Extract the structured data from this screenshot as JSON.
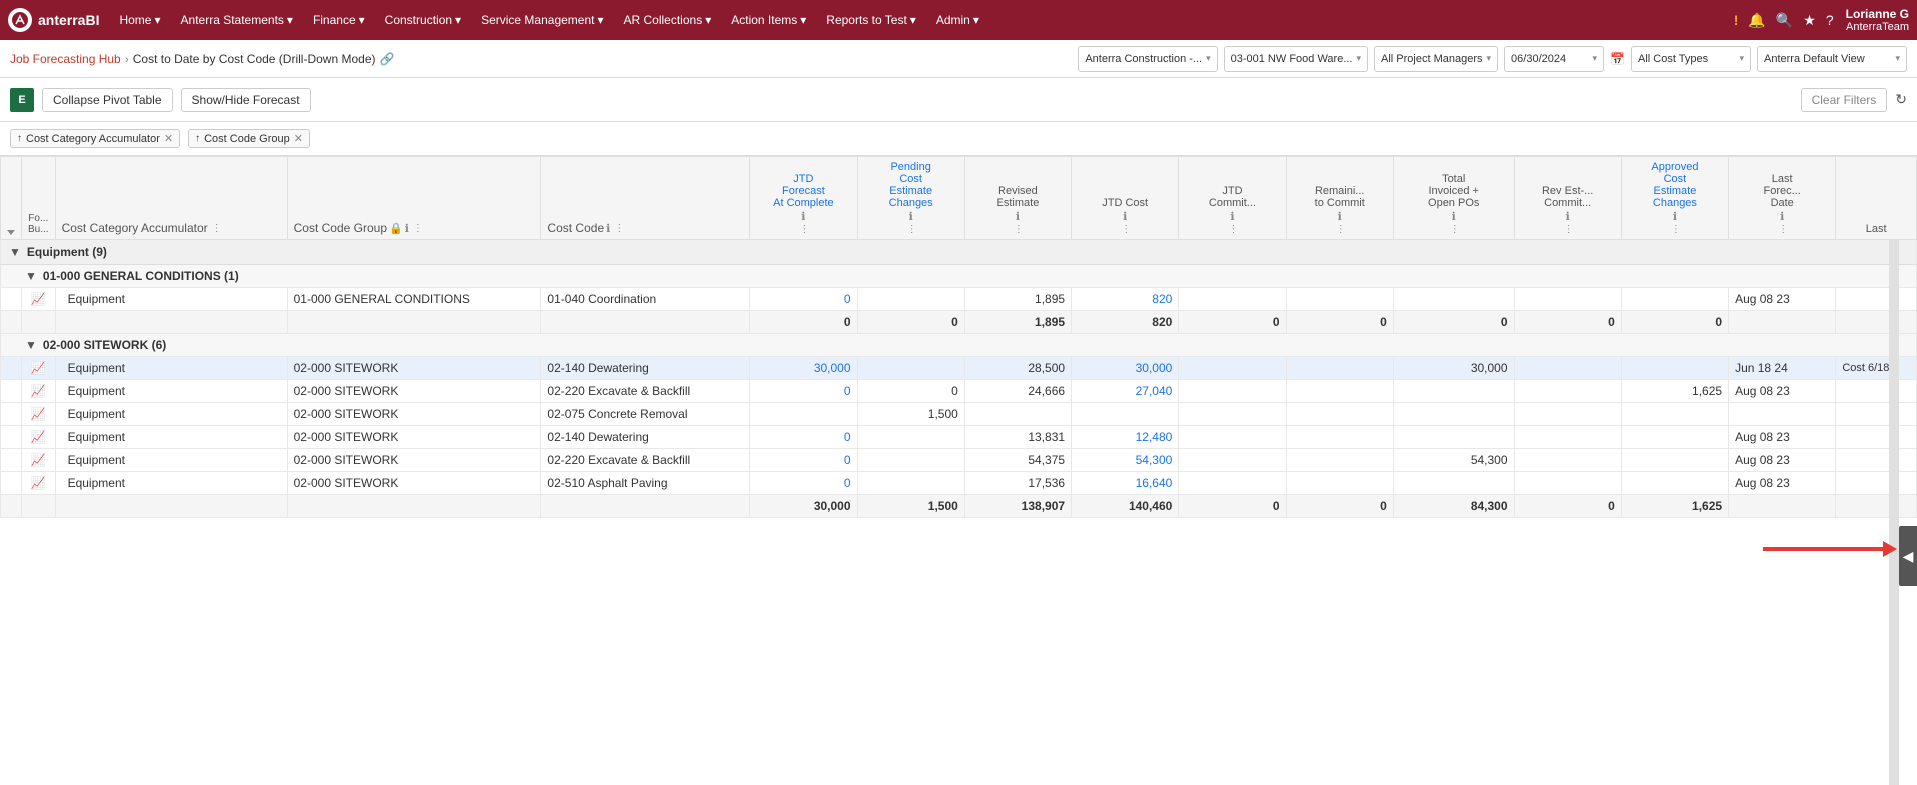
{
  "app": {
    "logo_text": "anterraBI",
    "logo_icon": "A"
  },
  "nav": {
    "items": [
      {
        "label": "Home",
        "has_dropdown": true
      },
      {
        "label": "Anterra Statements",
        "has_dropdown": true
      },
      {
        "label": "Finance",
        "has_dropdown": true
      },
      {
        "label": "Construction",
        "has_dropdown": true
      },
      {
        "label": "Service Management",
        "has_dropdown": true
      },
      {
        "label": "AR Collections",
        "has_dropdown": true
      },
      {
        "label": "Action Items",
        "has_dropdown": true
      },
      {
        "label": "Reports to Test",
        "has_dropdown": true
      },
      {
        "label": "Admin",
        "has_dropdown": true
      }
    ],
    "icons": {
      "exclamation": "!",
      "bell": "🔔",
      "search": "🔍",
      "star": "★",
      "help": "?"
    },
    "user": {
      "name": "Lorianne G",
      "company": "AnterraTeam"
    }
  },
  "breadcrumb": {
    "parent": "Job Forecasting Hub",
    "separator": ">",
    "current": "Cost to Date by Cost Code (Drill-Down Mode)",
    "icon": "🔗"
  },
  "filters": {
    "company": {
      "value": "Anterra Construction -...",
      "placeholder": "Anterra Construction -..."
    },
    "project": {
      "value": "03-001 NW Food Ware...",
      "placeholder": "03-001 NW Food Ware..."
    },
    "managers": {
      "value": "All Project Managers",
      "placeholder": "All Project Managers"
    },
    "date": {
      "value": "06/30/2024",
      "placeholder": "06/30/2024"
    },
    "calendar_icon": "📅",
    "cost_types": {
      "value": "All Cost Types",
      "placeholder": "All Cost Types"
    },
    "view": {
      "value": "Anterra Default View",
      "placeholder": "Anterra Default View"
    }
  },
  "toolbar": {
    "excel_label": "E",
    "collapse_label": "Collapse Pivot Table",
    "forecast_label": "Show/Hide Forecast",
    "clear_filters_label": "Clear Filters",
    "refresh_icon": "↻"
  },
  "active_filters": [
    {
      "label": "Cost Category Accumulator",
      "has_up": true
    },
    {
      "label": "Cost Code Group",
      "has_up": true
    }
  ],
  "table": {
    "columns": [
      {
        "id": "expand",
        "label": ""
      },
      {
        "id": "fo_bu",
        "label": "Fo... Bu..."
      },
      {
        "id": "cost_category",
        "label": "Cost Category Accumulator"
      },
      {
        "id": "cost_code_group",
        "label": "Cost Code Group"
      },
      {
        "id": "cost_code",
        "label": "Cost Code"
      },
      {
        "id": "jtd_forecast",
        "label": "JTD Forecast At Complete"
      },
      {
        "id": "pending_cost",
        "label": "Pending Cost Estimate Changes"
      },
      {
        "id": "revised_estimate",
        "label": "Revised Estimate"
      },
      {
        "id": "jtd_cost",
        "label": "JTD Cost"
      },
      {
        "id": "jtd_commit",
        "label": "JTD Commit..."
      },
      {
        "id": "remaining",
        "label": "Remaini... to Commit"
      },
      {
        "id": "total_invoiced",
        "label": "Total Invoiced + Open POs"
      },
      {
        "id": "rev_est_commit",
        "label": "Rev Est-... Commit..."
      },
      {
        "id": "approved_cost",
        "label": "Approved Cost Estimate Changes"
      },
      {
        "id": "last_forecast_date",
        "label": "Last Forec... Date"
      },
      {
        "id": "last",
        "label": "Last"
      }
    ],
    "sections": [
      {
        "type": "group",
        "label": "Equipment (9)",
        "expanded": true,
        "subsections": [
          {
            "type": "subgroup",
            "label": "01-000 GENERAL CONDITIONS (1)",
            "expanded": true,
            "rows": [
              {
                "fo_bu": "",
                "cost_category": "Equipment",
                "cost_code_group": "01-000 GENERAL CONDITIONS",
                "cost_code": "01-040 Coordination",
                "jtd_forecast": "0",
                "pending_cost": "",
                "revised_estimate": "1,895",
                "jtd_cost": "820",
                "jtd_commit": "",
                "remaining": "",
                "total_invoiced": "",
                "rev_est_commit": "",
                "approved_cost": "",
                "last_forecast_date": "Aug 08 23",
                "last": "",
                "blue_cols": [
                  "jtd_forecast",
                  "jtd_cost"
                ],
                "highlight": false
              }
            ],
            "summary": {
              "jtd_forecast": "0",
              "pending_cost": "0",
              "revised_estimate": "1,895",
              "jtd_cost": "820",
              "jtd_commit": "0",
              "remaining": "0",
              "total_invoiced": "0",
              "rev_est_commit": "0",
              "approved_cost": "0",
              "last_forecast_date": "",
              "last": ""
            }
          },
          {
            "type": "subgroup",
            "label": "02-000 SITEWORK (6)",
            "expanded": true,
            "rows": [
              {
                "fo_bu": "",
                "cost_category": "Equipment",
                "cost_code_group": "02-000 SITEWORK",
                "cost_code": "02-140 Dewatering",
                "jtd_forecast": "30,000",
                "pending_cost": "",
                "revised_estimate": "28,500",
                "jtd_cost": "30,000",
                "jtd_commit": "",
                "remaining": "",
                "total_invoiced": "30,000",
                "rev_est_commit": "",
                "approved_cost": "",
                "last_forecast_date": "Jun 18 24",
                "last": "Cost 6/18",
                "blue_cols": [
                  "jtd_forecast",
                  "jtd_cost"
                ],
                "highlight": true
              },
              {
                "fo_bu": "",
                "cost_category": "Equipment",
                "cost_code_group": "02-000 SITEWORK",
                "cost_code": "02-220 Excavate & Backfill",
                "jtd_forecast": "0",
                "pending_cost": "0",
                "revised_estimate": "24,666",
                "jtd_cost": "27,040",
                "jtd_commit": "",
                "remaining": "",
                "total_invoiced": "",
                "rev_est_commit": "",
                "approved_cost": "1,625",
                "last_forecast_date": "Aug 08 23",
                "last": "",
                "blue_cols": [
                  "jtd_forecast",
                  "jtd_cost"
                ],
                "highlight": false
              },
              {
                "fo_bu": "",
                "cost_category": "Equipment",
                "cost_code_group": "02-000 SITEWORK",
                "cost_code": "02-075 Concrete Removal",
                "jtd_forecast": "",
                "pending_cost": "1,500",
                "revised_estimate": "",
                "jtd_cost": "",
                "jtd_commit": "",
                "remaining": "",
                "total_invoiced": "",
                "rev_est_commit": "",
                "approved_cost": "",
                "last_forecast_date": "",
                "last": "",
                "blue_cols": [],
                "highlight": false
              },
              {
                "fo_bu": "",
                "cost_category": "Equipment",
                "cost_code_group": "02-000 SITEWORK",
                "cost_code": "02-140 Dewatering",
                "jtd_forecast": "0",
                "pending_cost": "",
                "revised_estimate": "13,831",
                "jtd_cost": "12,480",
                "jtd_commit": "",
                "remaining": "",
                "total_invoiced": "",
                "rev_est_commit": "",
                "approved_cost": "",
                "last_forecast_date": "Aug 08 23",
                "last": "",
                "blue_cols": [
                  "jtd_forecast",
                  "jtd_cost"
                ],
                "highlight": false
              },
              {
                "fo_bu": "",
                "cost_category": "Equipment",
                "cost_code_group": "02-000 SITEWORK",
                "cost_code": "02-220 Excavate & Backfill",
                "jtd_forecast": "0",
                "pending_cost": "",
                "revised_estimate": "54,375",
                "jtd_cost": "54,300",
                "jtd_commit": "",
                "remaining": "",
                "total_invoiced": "54,300",
                "rev_est_commit": "",
                "approved_cost": "",
                "last_forecast_date": "Aug 08 23",
                "last": "",
                "blue_cols": [
                  "jtd_forecast",
                  "jtd_cost"
                ],
                "highlight": false
              },
              {
                "fo_bu": "",
                "cost_category": "Equipment",
                "cost_code_group": "02-000 SITEWORK",
                "cost_code": "02-510 Asphalt Paving",
                "jtd_forecast": "0",
                "pending_cost": "",
                "revised_estimate": "17,536",
                "jtd_cost": "16,640",
                "jtd_commit": "",
                "remaining": "",
                "total_invoiced": "",
                "rev_est_commit": "",
                "approved_cost": "",
                "last_forecast_date": "Aug 08 23",
                "last": "",
                "blue_cols": [
                  "jtd_forecast",
                  "jtd_cost"
                ],
                "highlight": false
              }
            ],
            "summary": {
              "jtd_forecast": "30,000",
              "pending_cost": "1,500",
              "revised_estimate": "138,907",
              "jtd_cost": "140,460",
              "jtd_commit": "0",
              "remaining": "0",
              "total_invoiced": "84,300",
              "rev_est_commit": "0",
              "approved_cost": "1,625",
              "last_forecast_date": "",
              "last": ""
            }
          }
        ]
      }
    ]
  }
}
